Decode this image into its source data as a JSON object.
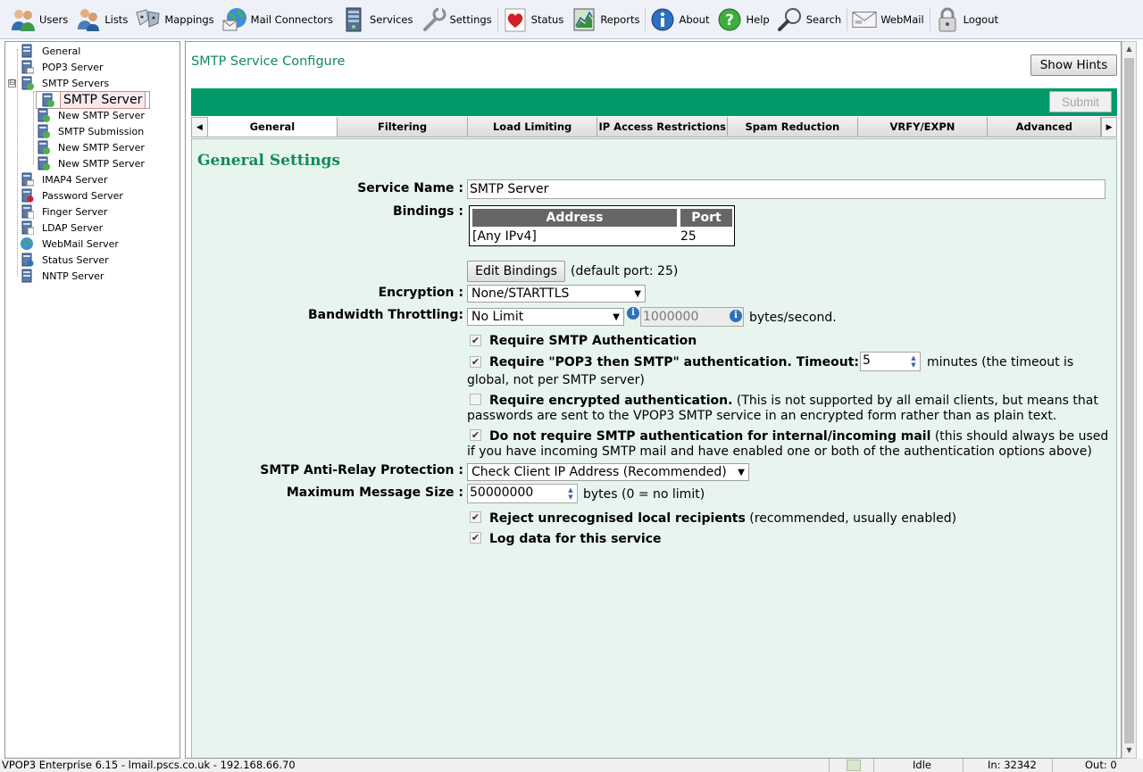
{
  "toolbar": {
    "items": [
      {
        "label": "Users",
        "icon": "users-icon"
      },
      {
        "label": "Lists",
        "icon": "lists-icon"
      },
      {
        "label": "Mappings",
        "icon": "mappings-icon"
      },
      {
        "label": "Mail Connectors",
        "icon": "mail-connectors-icon"
      },
      {
        "label": "Services",
        "icon": "services-icon"
      },
      {
        "label": "Settings",
        "icon": "wrench-icon"
      },
      {
        "label": "Status",
        "icon": "heart-icon"
      },
      {
        "label": "Reports",
        "icon": "reports-icon"
      },
      {
        "label": "About",
        "icon": "info-icon"
      },
      {
        "label": "Help",
        "icon": "help-icon"
      },
      {
        "label": "Search",
        "icon": "magnifier-icon"
      },
      {
        "label": "WebMail",
        "icon": "webmail-icon"
      },
      {
        "label": "Logout",
        "icon": "padlock-icon"
      }
    ]
  },
  "tree": {
    "items": [
      {
        "label": "General"
      },
      {
        "label": "POP3 Server"
      },
      {
        "label": "SMTP Servers"
      },
      {
        "label": "SMTP Server"
      },
      {
        "label": "New SMTP Server"
      },
      {
        "label": "SMTP Submission"
      },
      {
        "label": "New SMTP Server"
      },
      {
        "label": "New SMTP Server"
      },
      {
        "label": "IMAP4 Server"
      },
      {
        "label": "Password Server"
      },
      {
        "label": "Finger Server"
      },
      {
        "label": "LDAP Server"
      },
      {
        "label": "WebMail Server"
      },
      {
        "label": "Status Server"
      },
      {
        "label": "NNTP Server"
      }
    ],
    "expander": "⊟"
  },
  "page": {
    "title": "SMTP Service Configure",
    "hints_button": "Show Hints",
    "submit_button": "Submit"
  },
  "tabs": {
    "items": [
      {
        "label": "General"
      },
      {
        "label": "Filtering"
      },
      {
        "label": "Load Limiting"
      },
      {
        "label": "IP Access Restrictions"
      },
      {
        "label": "Spam Reduction"
      },
      {
        "label": "VRFY/EXPN"
      },
      {
        "label": "Advanced"
      }
    ],
    "active": "General"
  },
  "form": {
    "section_title": "General Settings",
    "service_name_label": "Service Name :",
    "service_name_value": "SMTP Server",
    "bindings_label": "Bindings :",
    "bindings_table": {
      "headers": [
        "Address",
        "Port"
      ],
      "rows": [
        [
          "[Any IPv4]",
          "25"
        ]
      ]
    },
    "edit_bindings_button": "Edit Bindings",
    "default_port_text": "(default port: 25)",
    "encryption_label": "Encryption :",
    "encryption_value": "None/STARTTLS",
    "bandwidth_label": "Bandwidth Throttling:",
    "bandwidth_value": "No Limit",
    "bandwidth_rate": "1000000",
    "bandwidth_units": "bytes/second.",
    "require_auth": {
      "checked": true,
      "label": "Require SMTP Authentication"
    },
    "pop3_then_smtp": {
      "checked": true,
      "label": "Require \"POP3 then SMTP\" authentication. Timeout:",
      "timeout": "5",
      "suffix": "minutes (the timeout is",
      "suffix2": "global, not per SMTP server)"
    },
    "encrypted_auth": {
      "checked": false,
      "label": "Require encrypted authentication.",
      "note": "(This is not supported by all email clients, but means that",
      "note2": "passwords are sent to the VPOP3 SMTP service in an encrypted form rather than as plain text."
    },
    "no_auth_internal": {
      "checked": true,
      "label": "Do not require SMTP authentication for internal/incoming mail",
      "note": "(this should always be used",
      "note2": "if you have incoming SMTP mail and have enabled one or both of the authentication options above)"
    },
    "antirelay_label": "SMTP Anti-Relay Protection :",
    "antirelay_value": "Check Client IP Address (Recommended)",
    "max_size_label": "Maximum Message Size :",
    "max_size_value": "50000000",
    "max_size_units": "bytes (0 = no limit)",
    "reject_unrecognised": {
      "checked": true,
      "label": "Reject unrecognised local recipients",
      "note": "(recommended, usually enabled)"
    },
    "log_data": {
      "checked": true,
      "label": "Log data for this service"
    }
  },
  "statusbar": {
    "left": "VPOP3 Enterprise 6.15 - lmail.pscs.co.uk - 192.168.66.70",
    "state": "Idle",
    "in": "In: 32342",
    "out": "Out: 0"
  },
  "colors": {
    "accent": "#00996a",
    "title_green": "#108a5c",
    "panel_bg": "#e8f4ee"
  }
}
